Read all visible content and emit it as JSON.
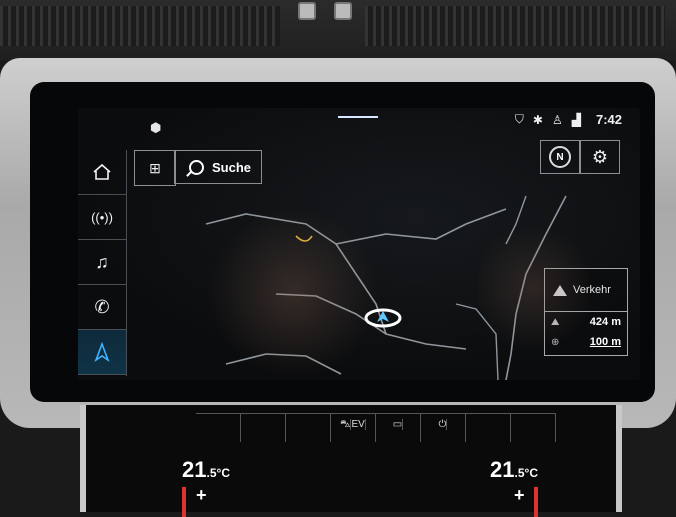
{
  "status_bar": {
    "icons": [
      "location-shield-icon",
      "bluetooth-icon",
      "user-icon",
      "signal-icon"
    ],
    "time": "7:42"
  },
  "sidebar": {
    "items": [
      {
        "name": "home",
        "icon": "home-icon"
      },
      {
        "name": "radio",
        "icon": "radio-icon"
      },
      {
        "name": "music",
        "icon": "music-icon"
      },
      {
        "name": "phone",
        "icon": "phone-icon"
      },
      {
        "name": "navigation",
        "icon": "navigation-arrow-icon",
        "active": true
      }
    ]
  },
  "toolbar": {
    "search_label": "Suche"
  },
  "map_controls": {
    "north_label": "N"
  },
  "traffic_panel": {
    "traffic_label": "Verkehr",
    "altitude": "424 m",
    "scale": "100 m"
  },
  "climate": {
    "temp_left": "21",
    "temp_left_decimal": "5",
    "temp_right": "21",
    "temp_right_decimal": "5",
    "unit": "°C",
    "ev_label": "EV"
  },
  "colors": {
    "accent": "#3fb4ff",
    "screen_bg": "#0b0c0e",
    "frame": "#b8b8b8"
  }
}
